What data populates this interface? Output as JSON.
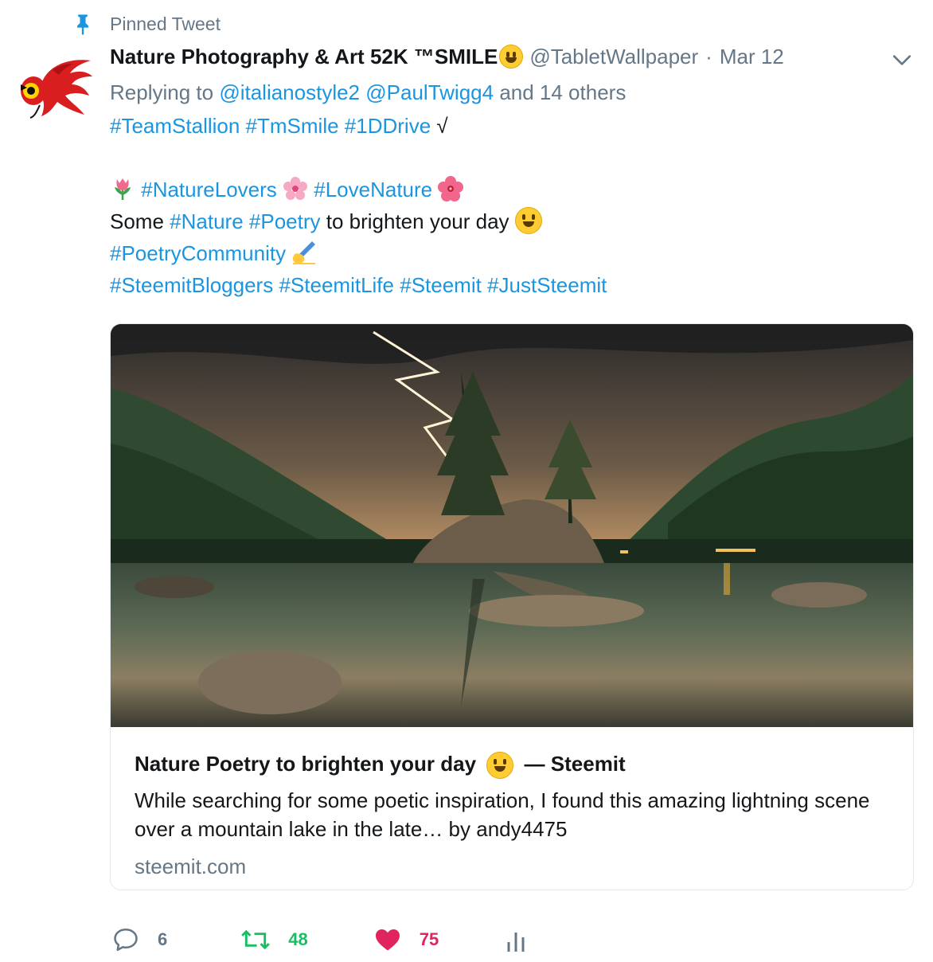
{
  "pinned": {
    "label": "Pinned Tweet"
  },
  "author": {
    "display_name": "Nature Photography & Art 52K ™SMILE",
    "handle": "@TabletWallpaper",
    "separator": "·",
    "date": "Mar 12"
  },
  "reply": {
    "prefix": "Replying to",
    "user1": "@italianostyle2",
    "user2": "@PaulTwigg4",
    "suffix": "and 14 others"
  },
  "text": {
    "line1_tags": [
      "#TeamStallion",
      "#TmSmile",
      "#1DDrive"
    ],
    "line1_end": "√",
    "line2_tags": [
      "#NatureLovers",
      "#LoveNature"
    ],
    "line3_pre": "Some",
    "line3_tags": [
      "#Nature",
      "#Poetry"
    ],
    "line3_post": "to brighten your day",
    "line4_tag": "#PoetryCommunity",
    "line5_tags": [
      "#SteemitBloggers",
      "#SteemitLife",
      "#Steemit",
      "#JustSteemit"
    ]
  },
  "card": {
    "title_pre": "Nature Poetry to brighten your day",
    "title_post": "— Steemit",
    "description": "While searching for some poetic inspiration, I found this amazing lightning scene over a mountain lake in the late… by andy4475",
    "domain": "steemit.com"
  },
  "actions": {
    "replies": "6",
    "retweets": "48",
    "likes": "75"
  },
  "colors": {
    "link": "#1b95e0",
    "muted": "#657786",
    "retweet": "#17bf63",
    "like": "#e0245e"
  },
  "icons": [
    "pin-icon",
    "avatar-dragon",
    "chevron-down-icon",
    "tulip-emoji",
    "cherry-blossom-emoji",
    "hibiscus-emoji",
    "grinning-face-emoji",
    "writing-hand-emoji",
    "reply-icon",
    "retweet-icon",
    "heart-icon",
    "analytics-icon"
  ]
}
